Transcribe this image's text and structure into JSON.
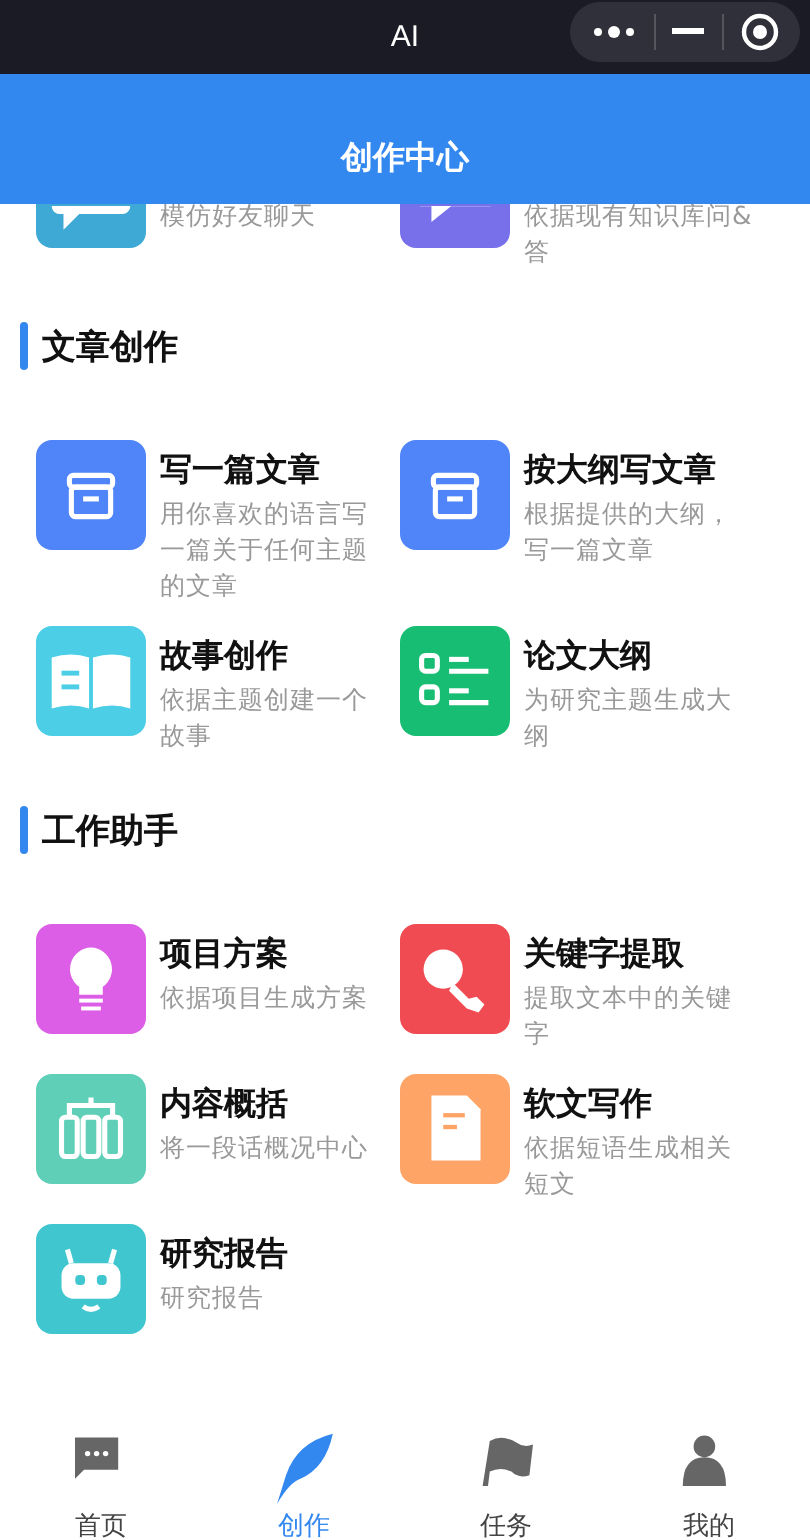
{
  "status_bar": {
    "title": "AI"
  },
  "header": {
    "title": "创作中心"
  },
  "partial_row": [
    {
      "description": "模仿好友聊天",
      "color": "#3fa9d5"
    },
    {
      "description": "依据现有知识库问&答",
      "color": "#7770ea"
    }
  ],
  "sections": [
    {
      "title": "文章创作",
      "items": [
        {
          "title": "写一篇文章",
          "description": "用你喜欢的语言写一篇关于任何主题的文章",
          "color": "#4f85f8"
        },
        {
          "title": "按大纲写文章",
          "description": "根据提供的大纲，写一篇文章",
          "color": "#4f85f8"
        },
        {
          "title": "故事创作",
          "description": "依据主题创建一个故事",
          "color": "#4ccfe6"
        },
        {
          "title": "论文大纲",
          "description": "为研究主题生成大纲",
          "color": "#16bd72"
        }
      ]
    },
    {
      "title": "工作助手",
      "items": [
        {
          "title": "项目方案",
          "description": "依据项目生成方案",
          "color": "#dc5ee6"
        },
        {
          "title": "关键字提取",
          "description": "提取文本中的关键字",
          "color": "#f04b52"
        },
        {
          "title": "内容概括",
          "description": "将一段话概况中心",
          "color": "#5fcfb8"
        },
        {
          "title": "软文写作",
          "description": "依据短语生成相关短文",
          "color": "#ffa467"
        },
        {
          "title": "研究报告",
          "description": "研究报告",
          "color": "#40c6cf"
        }
      ]
    }
  ],
  "tabs": [
    {
      "label": "首页",
      "selected": false
    },
    {
      "label": "创作",
      "selected": true
    },
    {
      "label": "任务",
      "selected": false
    },
    {
      "label": "我的",
      "selected": false
    }
  ]
}
